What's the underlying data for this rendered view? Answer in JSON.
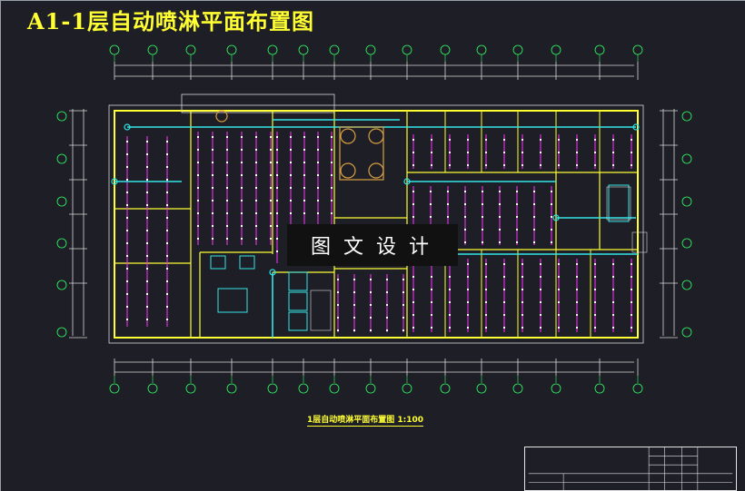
{
  "page_title": "A1-1层自动喷淋平面布置图",
  "watermark": "图文设计",
  "caption": "1层自动喷淋平面布置图  1:100",
  "colors": {
    "background": "#1e1e26",
    "wall": "#ffff33",
    "sprinkler_pipe": "#ff33ff",
    "water_pipe": "#33e6e6",
    "dimension": "#d9d9d9",
    "grid_axis": "#33ff66",
    "equipment": "#d9a040"
  }
}
